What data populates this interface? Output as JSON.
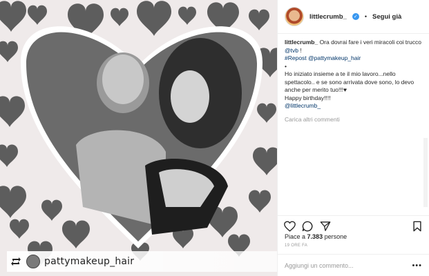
{
  "post": {
    "credit_name": "pattymakeup_hair"
  },
  "header": {
    "username": "littlecrumb_",
    "follow_label": "Segui già"
  },
  "caption": {
    "username": "littlecrumb_",
    "line1": "Ora dovrai fare i veri miracoli coi trucco",
    "mention_tvb": "@tvb",
    "line1_end": "!",
    "repost": "#Repost @pattymakeup_hair",
    "bullet": "•",
    "body": "Ho iniziato insieme a te il mio lavoro...nello spettacolo.. e se sono arrivata dove sono, lo devo anche per merito tuo!!!♥",
    "birthday": "Happy birthday!!!!",
    "signoff": "@littlecrumb_"
  },
  "load_more_label": "Carica altri commenti",
  "likes": {
    "prefix": "Piace a",
    "count": "7.383",
    "suffix": "persone"
  },
  "timestamp": "19 ORE FA",
  "comment_input": {
    "placeholder": "Aggiungi un commento..."
  },
  "colors": {
    "link": "#003569",
    "verified": "#3897f0"
  }
}
